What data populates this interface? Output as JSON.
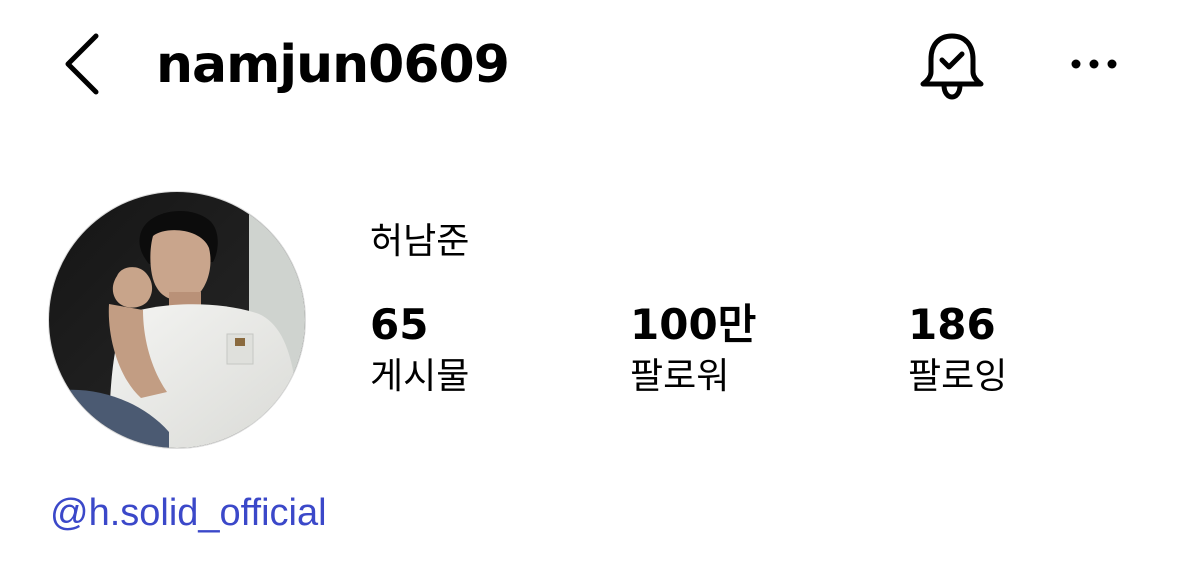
{
  "header": {
    "username": "namjun0609",
    "back_icon": "chevron-left-icon",
    "notification_icon": "bell-check-icon",
    "more_icon": "more-horizontal-icon"
  },
  "profile": {
    "display_name": "허남준",
    "avatar_alt": "profile photo",
    "stats": {
      "posts": {
        "value": "65",
        "label": "게시물"
      },
      "followers": {
        "value": "100만",
        "label": "팔로워"
      },
      "following": {
        "value": "186",
        "label": "팔로잉"
      }
    },
    "link": "@h.solid_official"
  },
  "colors": {
    "text": "#000000",
    "link": "#3b48c9",
    "background": "#ffffff"
  }
}
